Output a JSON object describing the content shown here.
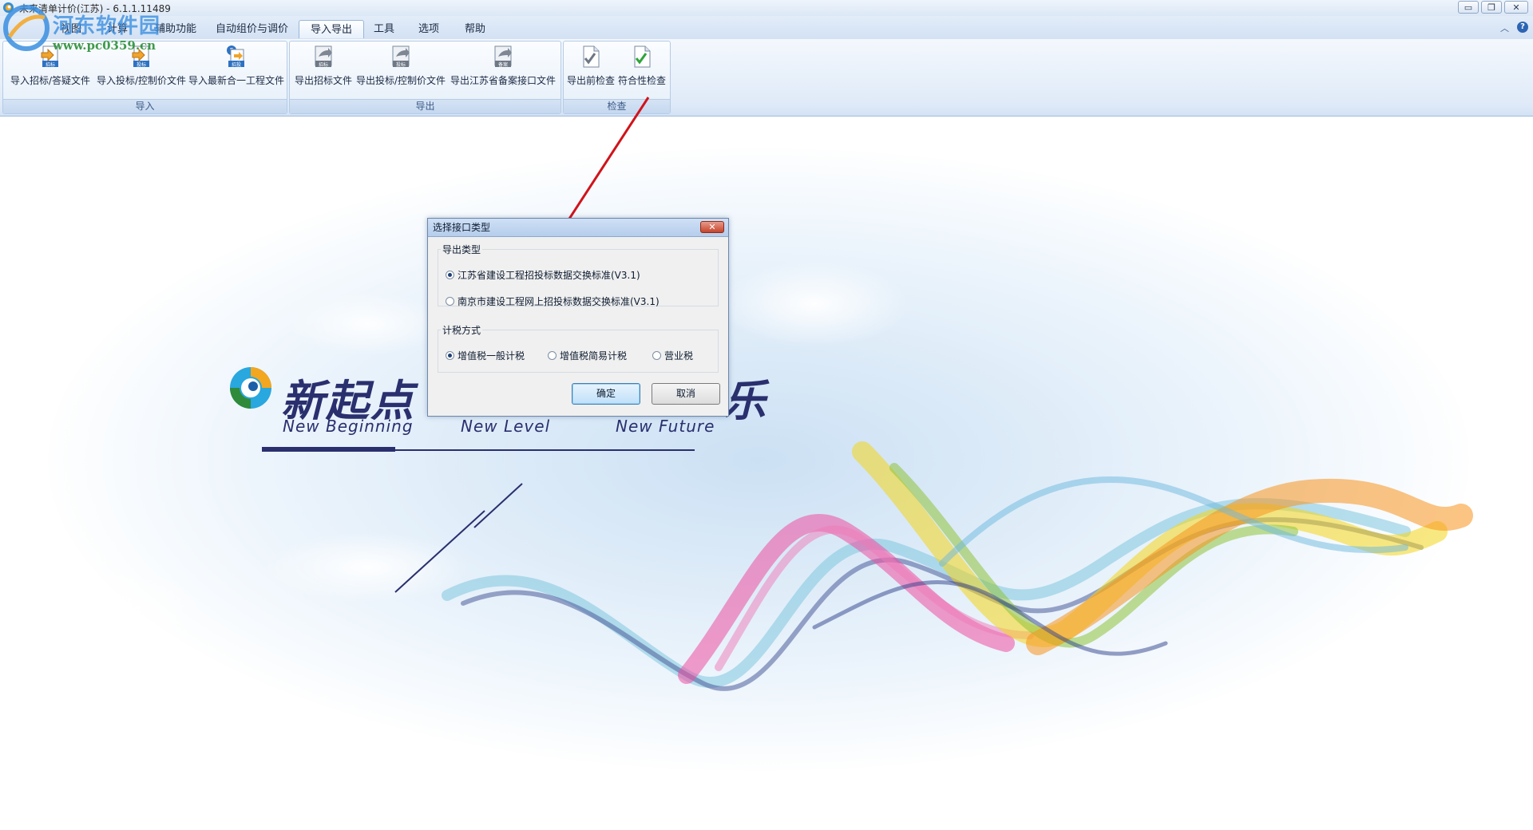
{
  "window": {
    "title": "未来清单计价(江苏) - 6.1.1.11489",
    "minimize_label": "▭",
    "restore_label": "❐",
    "close_label": "✕"
  },
  "watermark": {
    "title": "河东软件园",
    "url": "www.pc0359.cn"
  },
  "menu_tabs": [
    {
      "label": "视图"
    },
    {
      "label": "计算"
    },
    {
      "label": "辅助功能"
    },
    {
      "label": "自动组价与调价"
    },
    {
      "label": "导入导出",
      "active": true
    },
    {
      "label": "工具"
    },
    {
      "label": "选项"
    },
    {
      "label": "帮助"
    }
  ],
  "ribbon": {
    "groups": [
      {
        "label": "导入",
        "buttons": [
          {
            "label": "导入招标/答疑文件",
            "icon": "import-bid-icon",
            "badge": "招标"
          },
          {
            "label": "导入投标/控制价文件",
            "icon": "import-tender-icon",
            "badge": "投标"
          },
          {
            "label": "导入最新合一工程文件",
            "icon": "import-merge-icon",
            "badge": "招投"
          }
        ]
      },
      {
        "label": "导出",
        "buttons": [
          {
            "label": "导出招标文件",
            "icon": "export-bid-icon",
            "badge": "招标"
          },
          {
            "label": "导出投标/控制价文件",
            "icon": "export-tender-icon",
            "badge": "投标"
          },
          {
            "label": "导出江苏省备案接口文件",
            "icon": "export-filing-icon",
            "badge": "备案"
          }
        ]
      },
      {
        "label": "检查",
        "buttons": [
          {
            "label": "导出前检查",
            "icon": "pre-export-check-icon"
          },
          {
            "label": "符合性检查",
            "icon": "compliance-check-icon"
          }
        ]
      }
    ]
  },
  "splash": {
    "brand": "新起点",
    "brand_tail": "乐",
    "slogans": [
      "New Beginning",
      "New Level",
      "New Future"
    ]
  },
  "dialog": {
    "title": "选择接口类型",
    "close_label": "✕",
    "export_type": {
      "legend": "导出类型",
      "options": [
        {
          "label": "江苏省建设工程招投标数据交换标准(V3.1)",
          "selected": true
        },
        {
          "label": "南京市建设工程网上招投标数据交换标准(V3.1)",
          "selected": false
        }
      ]
    },
    "tax_method": {
      "legend": "计税方式",
      "options": [
        {
          "label": "增值税一般计税",
          "selected": true
        },
        {
          "label": "增值税简易计税",
          "selected": false
        },
        {
          "label": "营业税",
          "selected": false
        }
      ]
    },
    "ok_label": "确定",
    "cancel_label": "取消"
  },
  "colors": {
    "accent": "#2a2f6e",
    "ribbon_bg": "#dfeaf8",
    "annotation_arrow": "#d0131b"
  }
}
